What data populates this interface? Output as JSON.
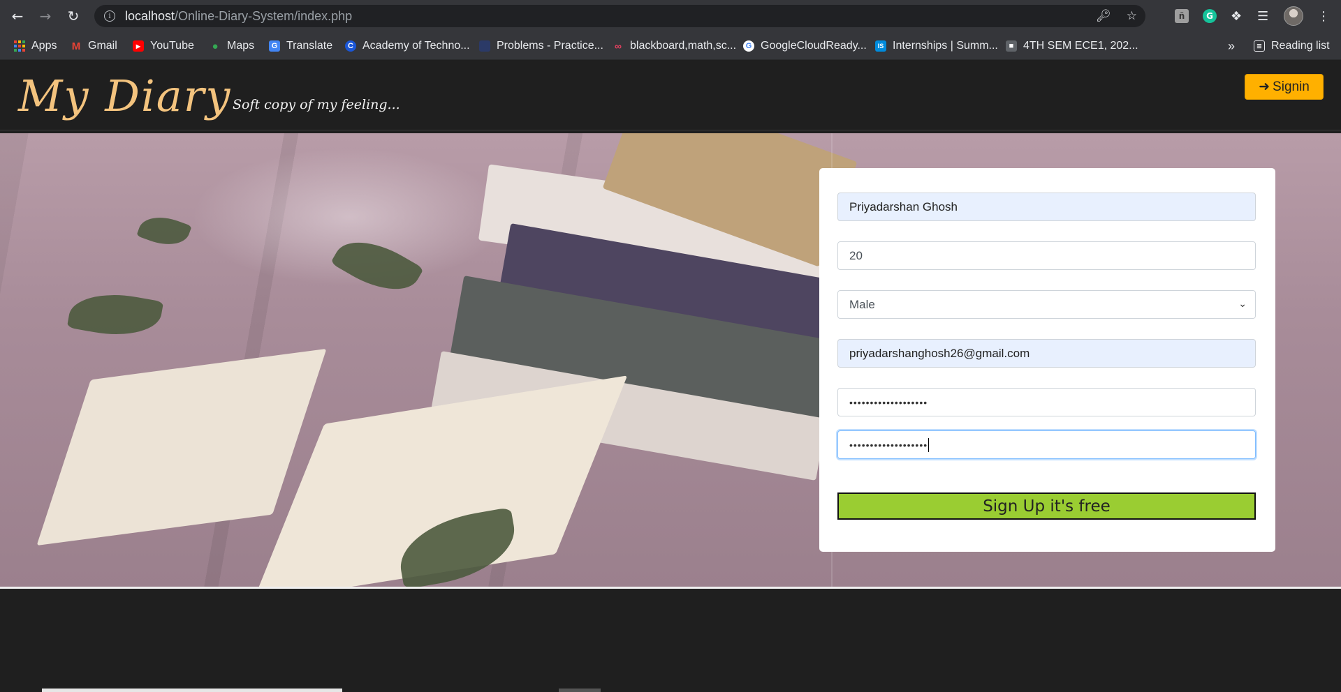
{
  "browser": {
    "url_host": "localhost",
    "url_path": "/Online-Diary-System/index.php",
    "reading_list": "Reading list",
    "overflow": "»",
    "bookmarks": [
      {
        "label": "Apps",
        "icon": "apps-grid-icon"
      },
      {
        "label": "Gmail",
        "icon": "gmail-icon"
      },
      {
        "label": "YouTube",
        "icon": "youtube-icon"
      },
      {
        "label": "Maps",
        "icon": "maps-icon"
      },
      {
        "label": "Translate",
        "icon": "translate-icon"
      },
      {
        "label": "Academy of Techno...",
        "icon": "academy-icon"
      },
      {
        "label": "Problems - Practice...",
        "icon": "practice-icon"
      },
      {
        "label": "blackboard,math,sc...",
        "icon": "blackboard-icon"
      },
      {
        "label": "GoogleCloudReady...",
        "icon": "google-icon"
      },
      {
        "label": "Internships | Summ...",
        "icon": "internshala-icon"
      },
      {
        "label": "4TH SEM ECE1, 202...",
        "icon": "classroom-icon"
      }
    ]
  },
  "site": {
    "brand": "My Diary",
    "tagline": "Soft copy of my feeling...",
    "signin_label": "Signin"
  },
  "form": {
    "name": "Priyadarshan Ghosh",
    "age": "20",
    "gender": "Male",
    "email": "priyadarshanghosh26@gmail.com",
    "password": "•••••••••••••••••••",
    "confirm_password": "•••••••••••••••••••",
    "submit_label": "Sign Up it's free"
  },
  "colors": {
    "brand": "#f3c37e",
    "signin": "#ffb000",
    "submit": "#9acd32",
    "header_bg": "#1f1f1f"
  }
}
